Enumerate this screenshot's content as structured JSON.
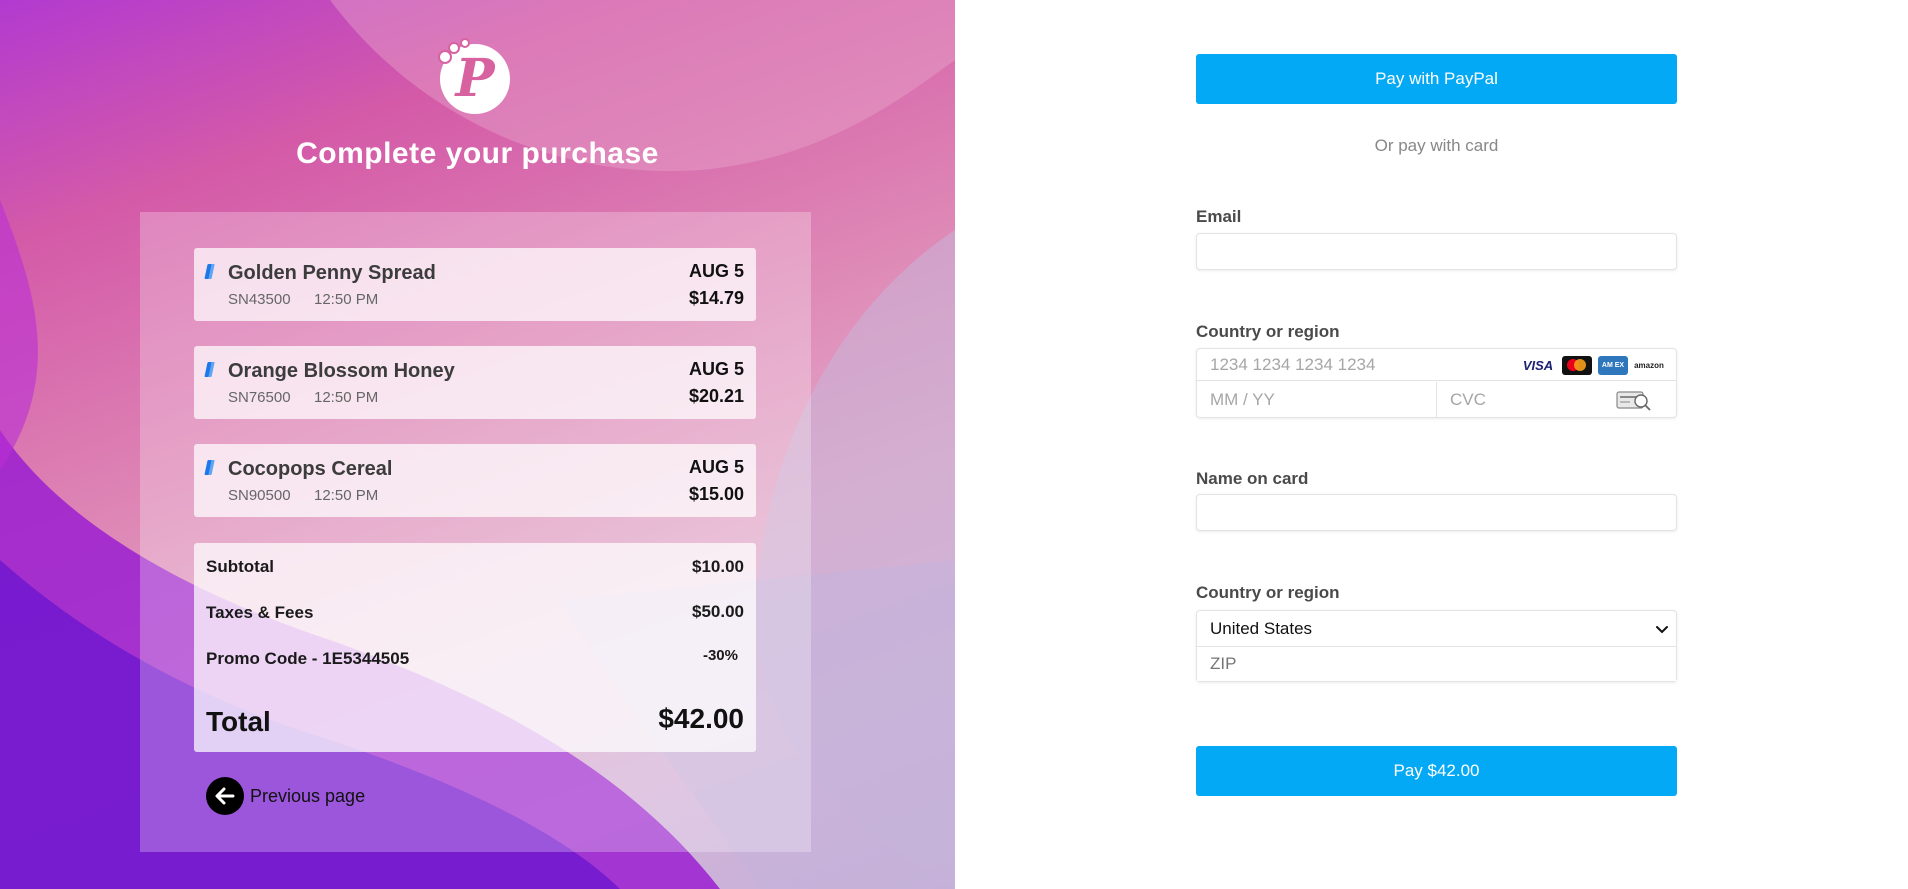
{
  "colors": {
    "accent": "#03a9f4",
    "logo": "#d8629f",
    "card_tag": "#1e78e8"
  },
  "brand": {
    "logo_letter": "P"
  },
  "page_title": "Complete your purchase",
  "items": [
    {
      "name": "Golden Penny Spread",
      "sku": "SN43500",
      "time": "12:50 PM",
      "date": "AUG 5",
      "price": "$14.79"
    },
    {
      "name": "Orange Blossom Honey",
      "sku": "SN76500",
      "time": "12:50 PM",
      "date": "AUG 5",
      "price": "$20.21"
    },
    {
      "name": "Cocopops Cereal",
      "sku": "SN90500",
      "time": "12:50 PM",
      "date": "AUG 5",
      "price": "$15.00"
    }
  ],
  "summary": {
    "subtotal_label": "Subtotal",
    "subtotal_value": "$10.00",
    "taxes_label": "Taxes & Fees",
    "taxes_value": "$50.00",
    "promo_label": "Promo Code - 1E5344505",
    "promo_value": "-30%",
    "total_label": "Total",
    "total_value": "$42.00"
  },
  "previous_page_label": "Previous page",
  "payment": {
    "paypal_label": "Pay with PayPal",
    "or_label": "Or pay with card",
    "email_label": "Email",
    "email_value": "",
    "card_section_label": "Country or region",
    "card_number_placeholder": "1234 1234 1234 1234",
    "expiry_placeholder": "MM / YY",
    "cvc_placeholder": "CVC",
    "card_brands": [
      "VISA",
      "mastercard-icon",
      "amex-icon",
      "amazon"
    ],
    "name_label": "Name on card",
    "name_value": "",
    "country_label": "Country or region",
    "country_value": "United States",
    "zip_placeholder": "ZIP",
    "pay_label": "Pay $42.00"
  }
}
